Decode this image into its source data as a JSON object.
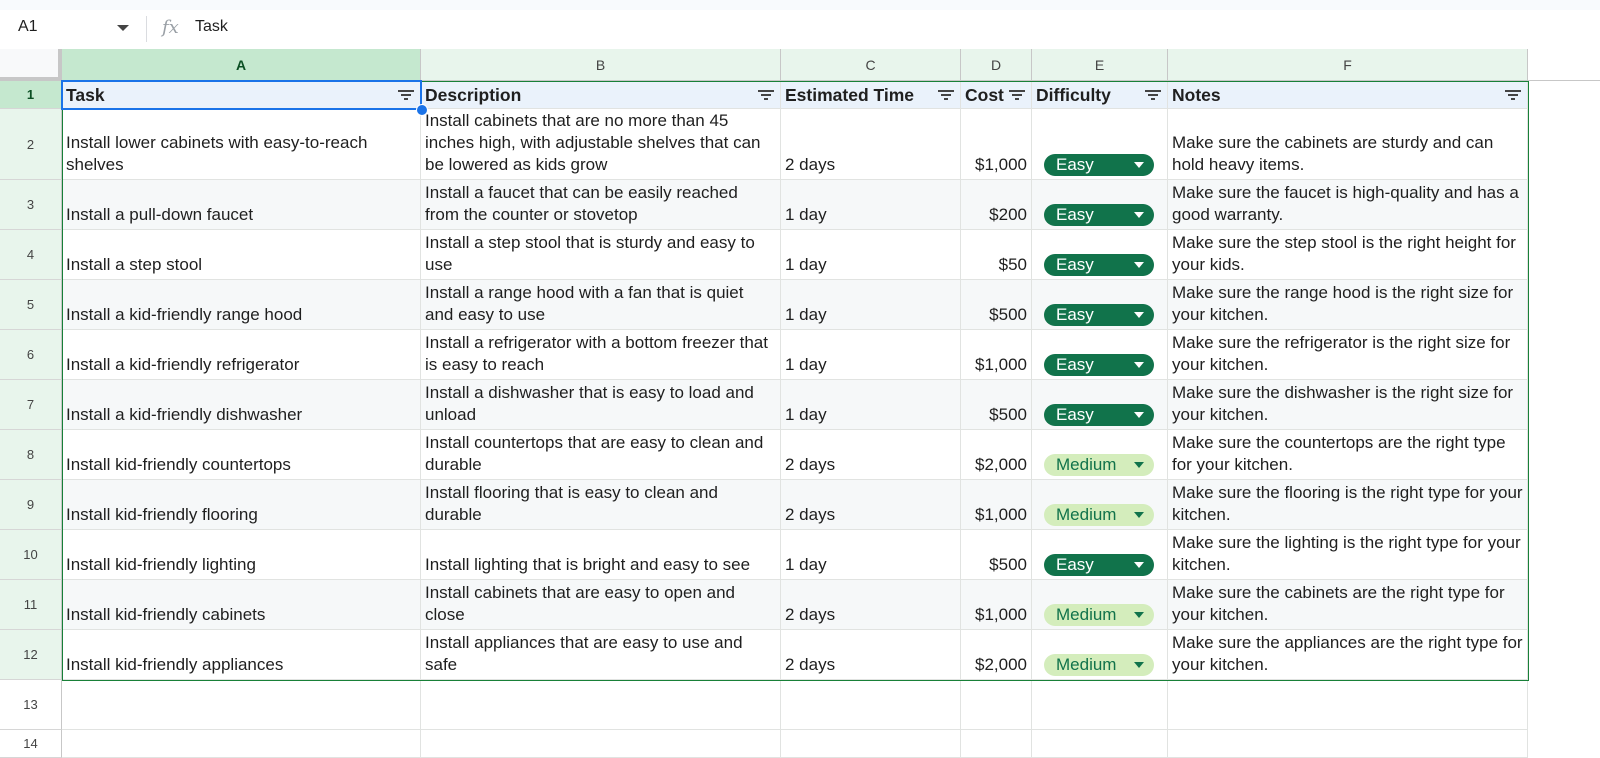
{
  "formula_bar": {
    "cell_ref": "A1",
    "fx": "fx",
    "value": "Task"
  },
  "columns": [
    "A",
    "B",
    "C",
    "D",
    "E",
    "F"
  ],
  "rows": [
    "1",
    "2",
    "3",
    "4",
    "5",
    "6",
    "7",
    "8",
    "9",
    "10",
    "11",
    "12",
    "13",
    "14"
  ],
  "header": [
    "Task",
    "Description",
    "Estimated Time",
    "Cost",
    "Difficulty",
    "Notes"
  ],
  "data": [
    {
      "task": "Install lower cabinets with easy-to-reach shelves",
      "desc": "Install cabinets that are no more than 45 inches high, with adjustable shelves that can be lowered as kids grow",
      "time": "2 days",
      "cost": "$1,000",
      "difficulty": "Easy",
      "notes": "Make sure the cabinets are sturdy and can hold heavy items."
    },
    {
      "task": "Install a pull-down faucet",
      "desc": "Install a faucet that can be easily reached from the counter or stovetop",
      "time": "1 day",
      "cost": "$200",
      "difficulty": "Easy",
      "notes": "Make sure the faucet is high-quality and has a good warranty."
    },
    {
      "task": "Install a step stool",
      "desc": "Install a step stool that is sturdy and easy to use",
      "time": "1 day",
      "cost": "$50",
      "difficulty": "Easy",
      "notes": "Make sure the step stool is the right height for your kids."
    },
    {
      "task": "Install a kid-friendly range hood",
      "desc": "Install a range hood with a fan that is quiet and easy to use",
      "time": "1 day",
      "cost": "$500",
      "difficulty": "Easy",
      "notes": "Make sure the range hood is the right size for your kitchen."
    },
    {
      "task": "Install a kid-friendly refrigerator",
      "desc": "Install a refrigerator with a bottom freezer that is easy to reach",
      "time": "1 day",
      "cost": "$1,000",
      "difficulty": "Easy",
      "notes": "Make sure the refrigerator is the right size for your kitchen."
    },
    {
      "task": "Install a kid-friendly dishwasher",
      "desc": "Install a dishwasher that is easy to load and unload",
      "time": "1 day",
      "cost": "$500",
      "difficulty": "Easy",
      "notes": "Make sure the dishwasher is the right size for your kitchen."
    },
    {
      "task": "Install kid-friendly countertops",
      "desc": "Install countertops that are easy to clean and durable",
      "time": "2 days",
      "cost": "$2,000",
      "difficulty": "Medium",
      "notes": "Make sure the countertops are the right type for your kitchen."
    },
    {
      "task": "Install kid-friendly flooring",
      "desc": "Install flooring that is easy to clean and durable",
      "time": "2 days",
      "cost": "$1,000",
      "difficulty": "Medium",
      "notes": "Make sure the flooring is the right type for your kitchen."
    },
    {
      "task": "Install kid-friendly lighting",
      "desc": "Install lighting that is bright and easy to see",
      "time": "1 day",
      "cost": "$500",
      "difficulty": "Easy",
      "notes": "Make sure the lighting is the right type for your kitchen."
    },
    {
      "task": "Install kid-friendly cabinets",
      "desc": "Install cabinets that are easy to open and close",
      "time": "2 days",
      "cost": "$1,000",
      "difficulty": "Medium",
      "notes": "Make sure the cabinets are the right type for your kitchen."
    },
    {
      "task": "Install kid-friendly appliances",
      "desc": "Install appliances that are easy to use and safe",
      "time": "2 days",
      "cost": "$2,000",
      "difficulty": "Medium",
      "notes": "Make sure the appliances are the right type for your kitchen."
    }
  ],
  "colors": {
    "easy_chip": "#11734b",
    "medium_chip": "#d4edbc",
    "selection": "#1a73e8",
    "table_border": "#188038"
  }
}
